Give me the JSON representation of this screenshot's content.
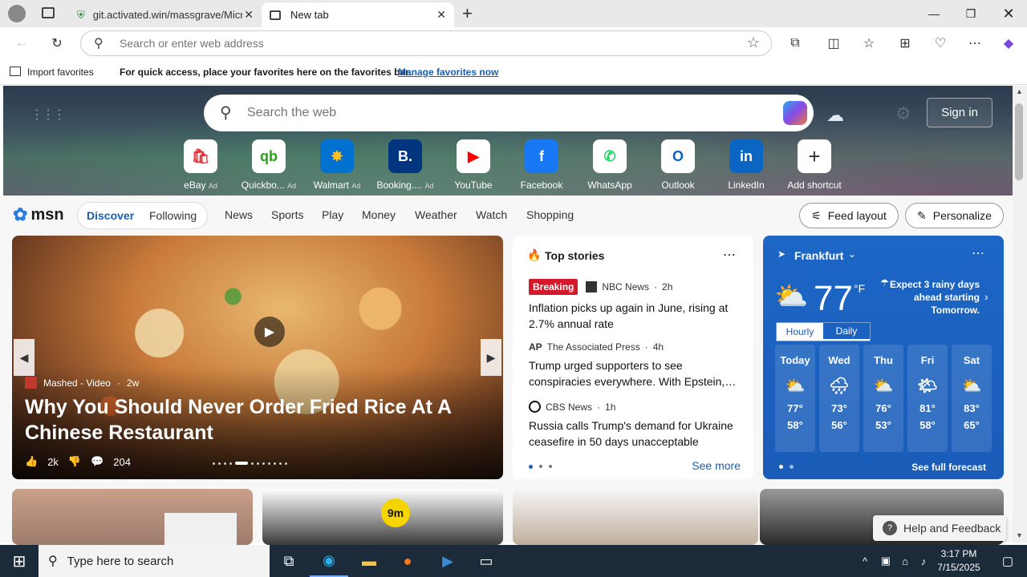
{
  "browser": {
    "tabs": [
      {
        "title": "git.activated.win/massgrave/Micr",
        "active": false
      },
      {
        "title": "New tab",
        "active": true
      }
    ],
    "address_placeholder": "Search or enter web address",
    "favbar": {
      "import_label": "Import favorites",
      "message": "For quick access, place your favorites here on the favorites bar.",
      "manage_link": "Manage favorites now"
    }
  },
  "newtab": {
    "search_placeholder": "Search the web",
    "signin_label": "Sign in",
    "shortcuts": [
      {
        "label": "eBay",
        "ad": "Ad",
        "icon": "ebay-icon"
      },
      {
        "label": "Quickbo...",
        "ad": "Ad",
        "icon": "quickbooks-icon"
      },
      {
        "label": "Walmart",
        "ad": "Ad",
        "icon": "walmart-icon"
      },
      {
        "label": "Booking....",
        "ad": "Ad",
        "icon": "booking-icon"
      },
      {
        "label": "YouTube",
        "ad": "",
        "icon": "youtube-icon"
      },
      {
        "label": "Facebook",
        "ad": "",
        "icon": "facebook-icon"
      },
      {
        "label": "WhatsApp",
        "ad": "",
        "icon": "whatsapp-icon"
      },
      {
        "label": "Outlook",
        "ad": "",
        "icon": "outlook-icon"
      },
      {
        "label": "LinkedIn",
        "ad": "",
        "icon": "linkedin-icon"
      },
      {
        "label": "Add shortcut",
        "ad": "",
        "icon": "plus-icon"
      }
    ]
  },
  "msn": {
    "logo": "msn",
    "tabs": {
      "discover": "Discover",
      "following": "Following"
    },
    "nav": [
      "News",
      "Sports",
      "Play",
      "Money",
      "Weather",
      "Watch",
      "Shopping"
    ],
    "feed_layout": "Feed layout",
    "personalize": "Personalize"
  },
  "feature": {
    "source": "Mashed - Video",
    "age": "2w",
    "headline": "Why You Should Never Order Fried Rice At A Chinese Restaurant",
    "likes": "2k",
    "comments": "204"
  },
  "top_stories": {
    "title": "Top stories",
    "items": [
      {
        "badge": "Breaking",
        "source": "NBC News",
        "age": "2h",
        "headline": "Inflation picks up again in June, rising at 2.7% annual rate"
      },
      {
        "badge": "",
        "source": "The Associated Press",
        "age": "4h",
        "headline": "Trump urged supporters to see conspiracies everywhere. With Epstein,…"
      },
      {
        "badge": "",
        "source": "CBS News",
        "age": "1h",
        "headline": "Russia calls Trump's demand for Ukraine ceasefire in 50 days unacceptable"
      }
    ],
    "see_more": "See more"
  },
  "weather": {
    "city": "Frankfurt",
    "temp": "77",
    "unit": "°F",
    "alert": "Expect 3 rainy days ahead starting Tomorrow.",
    "toggle": {
      "hourly": "Hourly",
      "daily": "Daily"
    },
    "days": [
      {
        "name": "Today",
        "hi": "77°",
        "lo": "58°"
      },
      {
        "name": "Wed",
        "hi": "73°",
        "lo": "56°"
      },
      {
        "name": "Thu",
        "hi": "76°",
        "lo": "53°"
      },
      {
        "name": "Fri",
        "hi": "81°",
        "lo": "58°"
      },
      {
        "name": "Sat",
        "hi": "83°",
        "lo": "65°"
      }
    ],
    "see_full": "See full forecast"
  },
  "second_row": {
    "badge": "9m"
  },
  "help": {
    "label": "Help and Feedback"
  },
  "taskbar": {
    "search_placeholder": "Type here to search",
    "time": "3:17 PM",
    "date": "7/15/2025"
  }
}
